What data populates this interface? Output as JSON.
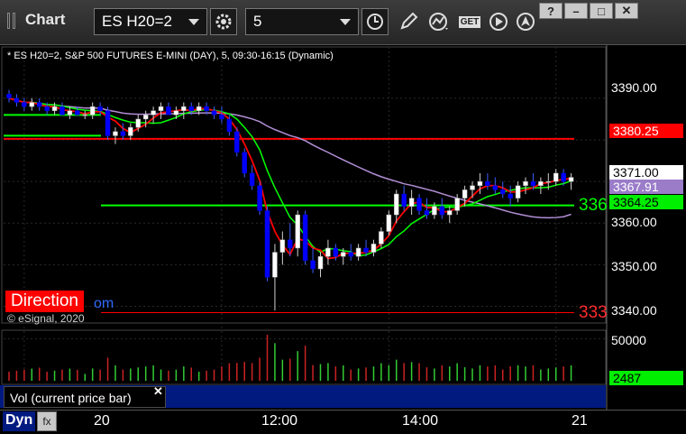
{
  "toolbar": {
    "title": "Chart",
    "symbol": "ES H20=2",
    "interval": "5",
    "icons": [
      "settings-gear-icon",
      "clock-icon",
      "pencil-icon",
      "indicator-icon",
      "get-icon",
      "play-icon",
      "location-icon"
    ],
    "get_label": "GET",
    "window_buttons": {
      "help": "?",
      "minimize": "–",
      "maximize": "□",
      "close": "✕"
    }
  },
  "chart": {
    "legend": "* ES H20=2, S&P 500 FUTURES E-MINI (DAY), 5, 09:30-16:15 (Dynamic)",
    "copyright": "© eSignal, 2020",
    "direction_label": "Direction",
    "direction_tail": "om",
    "price_axis": [
      "3390.00",
      "3380.25",
      "3371.00",
      "3367.91",
      "3364.25",
      "3360.00",
      "3350.00",
      "3340.00"
    ],
    "level_fragments": {
      "green": "336",
      "red": "333"
    },
    "colors": {
      "up": "#ffffff",
      "down": "#0000ff",
      "ma_fast": "#ff0000",
      "ma_mid": "#00ff00",
      "ma_slow": "#b28fd6",
      "level_red": "#ff0000",
      "level_green": "#00ff00"
    }
  },
  "chart_data": {
    "type": "candlestick",
    "ylim": [
      3336,
      3398
    ],
    "price_ticks": [
      3390,
      3380,
      3370,
      3360,
      3350,
      3340
    ],
    "levels": {
      "red_high": 3380.25,
      "green": 3364.25,
      "red_low": 3338.5
    },
    "last_price": 3371.0,
    "ma_value": 3367.91,
    "candles": [
      [
        3391,
        3392,
        3389,
        3390
      ],
      [
        3390,
        3391,
        3388,
        3389
      ],
      [
        3389,
        3390,
        3387,
        3388
      ],
      [
        3388,
        3390,
        3387,
        3389
      ],
      [
        3389,
        3390,
        3387,
        3388
      ],
      [
        3388,
        3389,
        3386,
        3387
      ],
      [
        3387,
        3389,
        3386,
        3388
      ],
      [
        3388,
        3389,
        3386,
        3386
      ],
      [
        3386,
        3388,
        3385,
        3387
      ],
      [
        3387,
        3388,
        3386,
        3386
      ],
      [
        3386,
        3387,
        3385,
        3386
      ],
      [
        3386,
        3389,
        3385,
        3388
      ],
      [
        3388,
        3389,
        3386,
        3387
      ],
      [
        3387,
        3388,
        3380,
        3381
      ],
      [
        3381,
        3383,
        3379,
        3382
      ],
      [
        3382,
        3384,
        3380,
        3381
      ],
      [
        3381,
        3384,
        3380,
        3383
      ],
      [
        3383,
        3386,
        3382,
        3385
      ],
      [
        3385,
        3387,
        3383,
        3386
      ],
      [
        3386,
        3388,
        3384,
        3387
      ],
      [
        3387,
        3389,
        3385,
        3388
      ],
      [
        3388,
        3389,
        3386,
        3386
      ],
      [
        3386,
        3388,
        3385,
        3387
      ],
      [
        3387,
        3389,
        3385,
        3388
      ],
      [
        3388,
        3389,
        3386,
        3387
      ],
      [
        3387,
        3389,
        3386,
        3388
      ],
      [
        3388,
        3389,
        3386,
        3387
      ],
      [
        3387,
        3388,
        3385,
        3386
      ],
      [
        3386,
        3388,
        3384,
        3385
      ],
      [
        3385,
        3386,
        3381,
        3382
      ],
      [
        3382,
        3383,
        3376,
        3377
      ],
      [
        3377,
        3378,
        3371,
        3372
      ],
      [
        3372,
        3374,
        3368,
        3369
      ],
      [
        3369,
        3370,
        3362,
        3363
      ],
      [
        3363,
        3364,
        3346,
        3347
      ],
      [
        3347,
        3355,
        3339,
        3353
      ],
      [
        3353,
        3358,
        3350,
        3356
      ],
      [
        3356,
        3360,
        3352,
        3354
      ],
      [
        3354,
        3363,
        3352,
        3362
      ],
      [
        3362,
        3363,
        3350,
        3351
      ],
      [
        3351,
        3354,
        3348,
        3349
      ],
      [
        3349,
        3353,
        3347,
        3352
      ],
      [
        3352,
        3356,
        3350,
        3354
      ],
      [
        3354,
        3355,
        3351,
        3352
      ],
      [
        3352,
        3354,
        3350,
        3353
      ],
      [
        3353,
        3355,
        3351,
        3352
      ],
      [
        3352,
        3355,
        3351,
        3354
      ],
      [
        3354,
        3356,
        3352,
        3353
      ],
      [
        3353,
        3356,
        3352,
        3355
      ],
      [
        3355,
        3359,
        3354,
        3358
      ],
      [
        3358,
        3363,
        3357,
        3362
      ],
      [
        3362,
        3368,
        3360,
        3367
      ],
      [
        3367,
        3369,
        3363,
        3364
      ],
      [
        3364,
        3368,
        3362,
        3366
      ],
      [
        3366,
        3367,
        3362,
        3363
      ],
      [
        3363,
        3366,
        3361,
        3362
      ],
      [
        3362,
        3365,
        3361,
        3364
      ],
      [
        3364,
        3366,
        3361,
        3362
      ],
      [
        3362,
        3364,
        3360,
        3363
      ],
      [
        3363,
        3367,
        3362,
        3366
      ],
      [
        3366,
        3369,
        3364,
        3368
      ],
      [
        3368,
        3370,
        3366,
        3369
      ],
      [
        3369,
        3372,
        3367,
        3370
      ],
      [
        3370,
        3372,
        3368,
        3369
      ],
      [
        3369,
        3371,
        3367,
        3368
      ],
      [
        3368,
        3370,
        3366,
        3367
      ],
      [
        3367,
        3369,
        3364,
        3366
      ],
      [
        3366,
        3370,
        3365,
        3369
      ],
      [
        3369,
        3371,
        3367,
        3370
      ],
      [
        3370,
        3372,
        3368,
        3369
      ],
      [
        3369,
        3371,
        3367,
        3370
      ],
      [
        3370,
        3372,
        3368,
        3370
      ],
      [
        3370,
        3373,
        3369,
        3372
      ],
      [
        3372,
        3373,
        3369,
        3370
      ],
      [
        3370,
        3372,
        3368,
        3371
      ]
    ],
    "volume_ylim": [
      0,
      60000
    ],
    "volume_ticks": [
      50000
    ],
    "last_volume": 2487,
    "time_ticks": [
      "20",
      "12:00",
      "14:00",
      "21"
    ]
  },
  "volume": {
    "label": "Vol (current price bar)",
    "axis_top": "50000",
    "last_value": "2487",
    "close": "✕"
  },
  "bottom": {
    "dyn_label": "Dyn",
    "dyn_icon": "fx"
  }
}
